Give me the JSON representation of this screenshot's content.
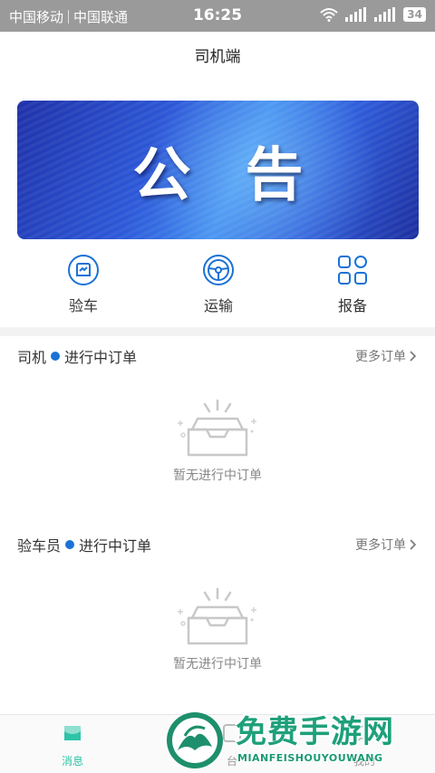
{
  "status_bar": {
    "carrier1": "中国移动",
    "carrier2": "中国联通",
    "time": "16:25",
    "battery": "34",
    "icons": [
      "wifi-icon",
      "signal-icon",
      "signal-icon"
    ]
  },
  "header": {
    "title": "司机端"
  },
  "banner": {
    "char1": "公",
    "char2": "告"
  },
  "quick_menu": [
    {
      "label": "验车",
      "icon": "car-inspect-icon"
    },
    {
      "label": "运输",
      "icon": "steering-wheel-icon"
    },
    {
      "label": "报备",
      "icon": "grid-apps-icon"
    }
  ],
  "sections": [
    {
      "role": "司机",
      "title": "进行中订单",
      "more": "更多订单",
      "empty_text": "暂无进行中订单"
    },
    {
      "role": "验车员",
      "title": "进行中订单",
      "more": "更多订单",
      "empty_text": "暂无进行中订单"
    }
  ],
  "tab_bar": [
    {
      "label": "消息",
      "icon": "message-icon",
      "active": true
    },
    {
      "label": "台",
      "icon": "workbench-icon",
      "active": false
    },
    {
      "label": "我的",
      "icon": "profile-icon",
      "active": false
    }
  ],
  "watermark": {
    "text": "免费手游网",
    "subtext": "MIANFEISHOUYOUWANG"
  },
  "colors": {
    "accent": "#1a72d6",
    "tab_active": "#2ec4a8",
    "watermark": "#1ea07a"
  }
}
